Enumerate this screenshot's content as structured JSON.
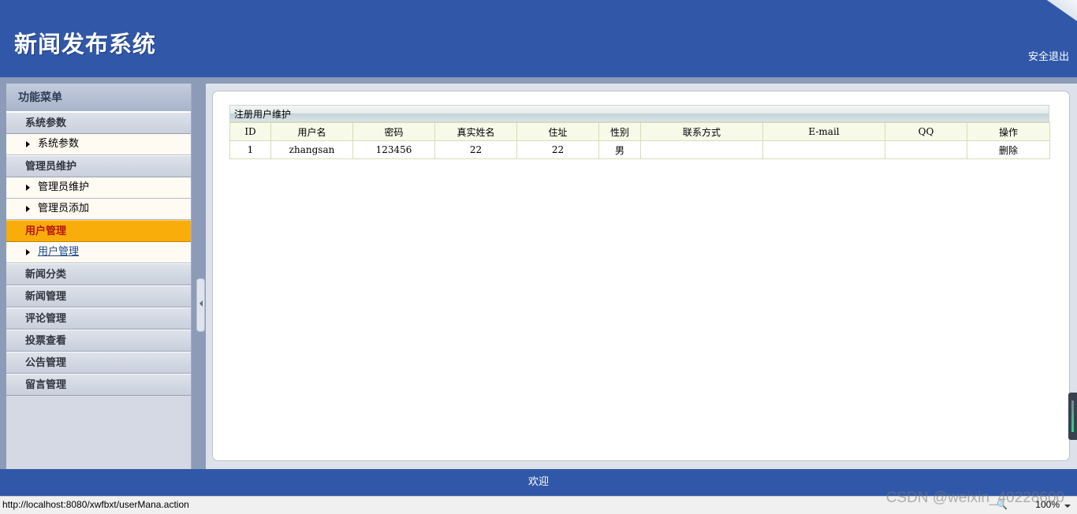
{
  "header": {
    "title": "新闻发布系统",
    "logout": "安全退出"
  },
  "sidebar": {
    "title": "功能菜单",
    "groups": [
      {
        "label": "系统参数",
        "items": [
          "系统参数"
        ]
      },
      {
        "label": "管理员维护",
        "items": [
          "管理员维护",
          "管理员添加"
        ]
      },
      {
        "label": "用户管理",
        "items": [
          "用户管理"
        ],
        "active": true
      },
      {
        "label": "新闻分类",
        "items": []
      },
      {
        "label": "新闻管理",
        "items": []
      },
      {
        "label": "评论管理",
        "items": []
      },
      {
        "label": "投票查看",
        "items": []
      },
      {
        "label": "公告管理",
        "items": []
      },
      {
        "label": "留言管理",
        "items": []
      }
    ]
  },
  "main": {
    "caption": "注册用户维护",
    "columns": [
      "ID",
      "用户名",
      "密码",
      "真实姓名",
      "住址",
      "性别",
      "联系方式",
      "E-mail",
      "QQ",
      "操作"
    ],
    "rows": [
      {
        "id": "1",
        "username": "zhangsan",
        "password": "123456",
        "realname": "22",
        "address": "22",
        "gender": "男",
        "contact": "",
        "email": "",
        "qq": "",
        "action": "删除"
      }
    ]
  },
  "footer": {
    "text": "欢迎"
  },
  "statusbar": {
    "url": "http://localhost:8080/xwfbxt/userMana.action",
    "zoom": "100%"
  },
  "watermark": "CSDN @weixin_40228600"
}
